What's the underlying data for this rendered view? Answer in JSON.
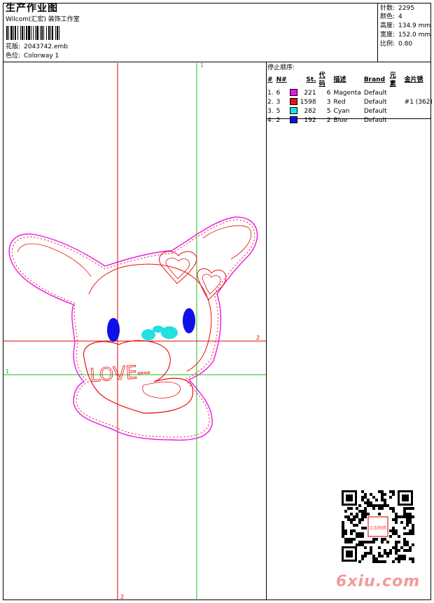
{
  "header": {
    "title": "生产作业图",
    "company": "Wilcom(汇宏) 装饰工作室",
    "design_label": "花版:",
    "design_file": "2043742.emb",
    "colorway_label": "色位:",
    "colorway": "Colorway 1"
  },
  "stats": [
    {
      "label": "针数:",
      "value": "2295"
    },
    {
      "label": "颜色:",
      "value": "4"
    },
    {
      "label": "高度:",
      "value": "134.9 mm"
    },
    {
      "label": "宽度:",
      "value": "152.0 mm"
    },
    {
      "label": "比例:",
      "value": "0.80"
    }
  ],
  "stop_sequence": {
    "title": "停止顺序:",
    "columns": [
      "#",
      "N#",
      "St.",
      "代码",
      "描述",
      "Brand",
      "元素",
      "金片锈"
    ],
    "rows": [
      {
        "idx": "1.",
        "n": "6",
        "color": "#e815e8",
        "st": "221",
        "code": "6",
        "desc": "Magenta",
        "brand": "Default",
        "elem": "",
        "seq": ""
      },
      {
        "idx": "2.",
        "n": "3",
        "color": "#e81010",
        "st": "1598",
        "code": "3",
        "desc": "Red",
        "brand": "Default",
        "elem": "",
        "seq": "#1 (362)"
      },
      {
        "idx": "3.",
        "n": "5",
        "color": "#22e0e0",
        "st": "282",
        "code": "5",
        "desc": "Cyan",
        "brand": "Default",
        "elem": "",
        "seq": ""
      },
      {
        "idx": "4.",
        "n": "2",
        "color": "#1010e8",
        "st": "192",
        "code": "2",
        "desc": "Blue",
        "brand": "Default",
        "elem": "",
        "seq": ""
      }
    ]
  },
  "guides": {
    "v1": "1",
    "v2": "2",
    "h1": "1",
    "h2": "2",
    "red_color": "#e00000",
    "green_color": "#18c018"
  },
  "design": {
    "text": "LOVE--",
    "outline_color": "#e81010",
    "border_color": "#e815e8",
    "eye_color": "#1010e8",
    "nose_color": "#22e0e0"
  },
  "watermark": {
    "qr_seal": "汇宏刺绣",
    "logo": "6xiu.com",
    "logo_color": "#f49a9a"
  }
}
